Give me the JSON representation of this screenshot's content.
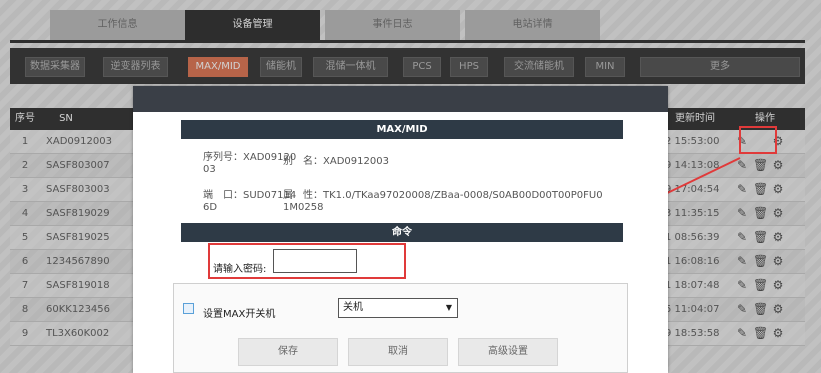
{
  "tabs": [
    "工作信息",
    "设备管理",
    "事件日志",
    "电站详情"
  ],
  "active_tab": "设备管理",
  "subnav": [
    "数据采集器",
    "逆变器列表",
    "MAX/MID",
    "储能机",
    "混储一体机",
    "PCS",
    "HPS",
    "交流储能机",
    "MIN",
    "更多"
  ],
  "active_subnav": "MAX/MID",
  "table": {
    "headers": [
      "序号",
      "SN",
      "更新时间",
      "操作"
    ],
    "rows": [
      {
        "num": "1",
        "sn": "XAD0912003",
        "time": "2 15:53:00"
      },
      {
        "num": "2",
        "sn": "SASF803007",
        "time": "9 14:13:08"
      },
      {
        "num": "3",
        "sn": "SASF803003",
        "time": "9 17:04:54"
      },
      {
        "num": "4",
        "sn": "SASF819029",
        "time": "3 11:35:15"
      },
      {
        "num": "5",
        "sn": "SASF819025",
        "time": "1 08:56:39"
      },
      {
        "num": "6",
        "sn": "1234567890",
        "time": "1 16:08:16"
      },
      {
        "num": "7",
        "sn": "SASF819018",
        "time": "1 18:07:48"
      },
      {
        "num": "8",
        "sn": "60KK123456",
        "time": "5 11:04:07"
      },
      {
        "num": "9",
        "sn": "TL3X60K002",
        "time": "9 18:53:58"
      }
    ]
  },
  "modal": {
    "title": "MAX/MID",
    "serial_line1": "序列号：XAD09120",
    "serial_line2": "03",
    "alias": "别　名：XAD0912003",
    "port_line1": "端　口：SUD07114",
    "port_line2": "6D",
    "attr_line1": "属　性：TK1.0/TKaa97020008/ZBaa-0008/S0AB00D00T00P0FU0",
    "attr_line2": "1M0258",
    "command_title": "命令",
    "password_label": "请输入密码:",
    "password_value": "",
    "command_label": "设置MAX开关机",
    "select_value": "关机",
    "buttons": {
      "save": "保存",
      "cancel": "取消",
      "advanced": "高级设置"
    }
  },
  "colors": {
    "highlight": "#e03a3a",
    "header_dark": "#3a3a3a",
    "active_orange": "#e07a5a"
  }
}
